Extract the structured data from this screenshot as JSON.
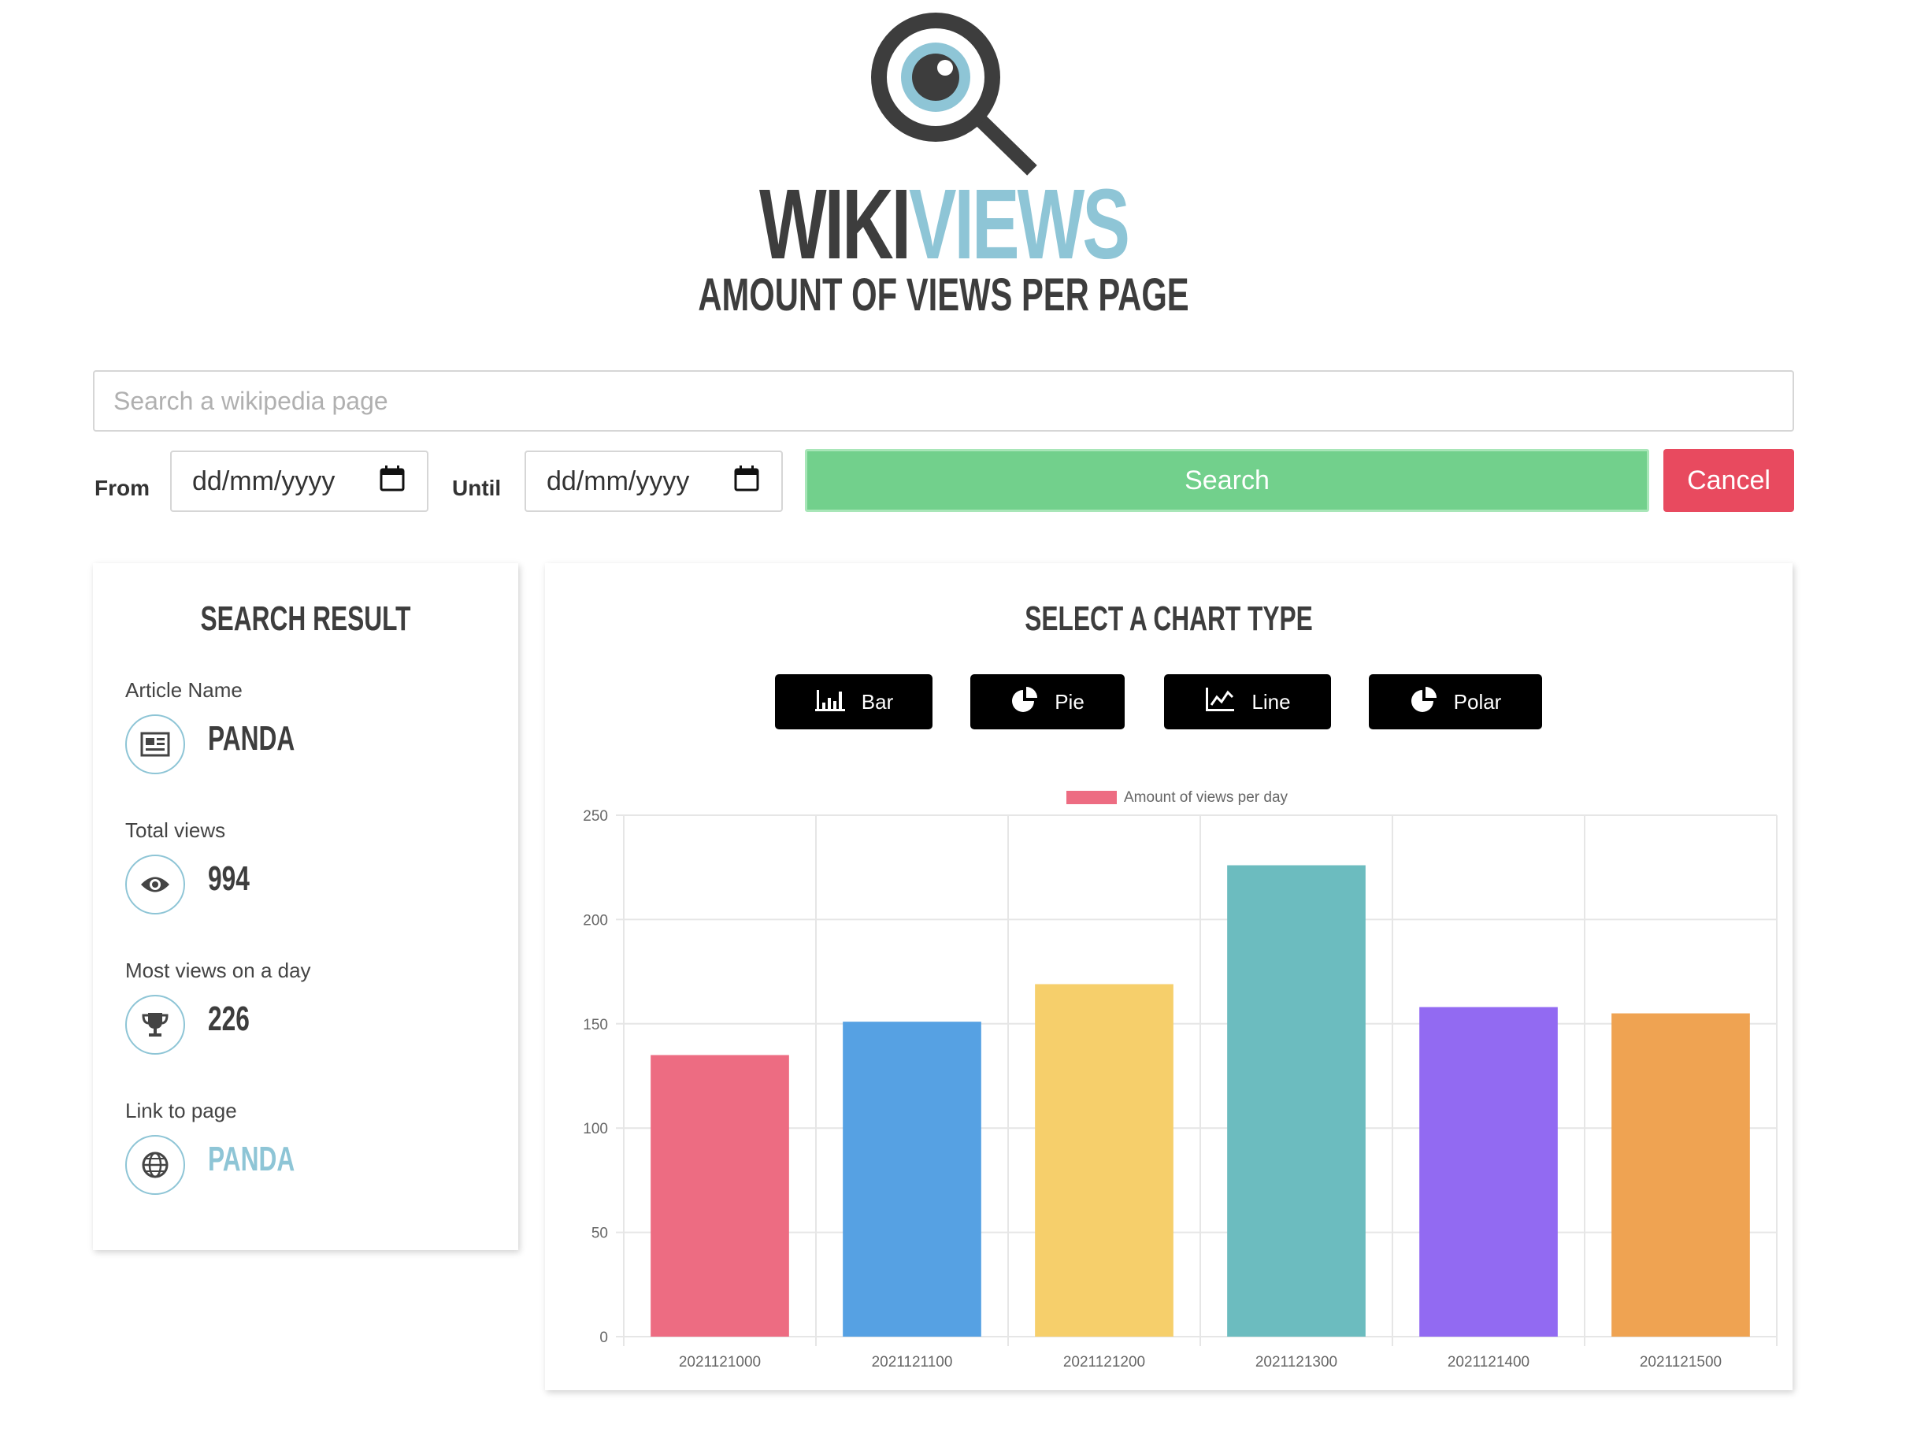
{
  "header": {
    "title_part1": "WIKI",
    "title_part2": "VIEWS",
    "subtitle": "AMOUNT OF VIEWS PER PAGE",
    "logo_icon": "magnifier-eye-icon"
  },
  "search": {
    "placeholder": "Search a wikipedia page",
    "value": ""
  },
  "dates": {
    "from_label": "From",
    "until_label": "Until",
    "from_value": "dd/mm/yyyy",
    "until_value": "dd/mm/yyyy"
  },
  "buttons": {
    "search": "Search",
    "cancel": "Cancel"
  },
  "result": {
    "title": "SEARCH RESULT",
    "article_label": "Article Name",
    "article_value": "PANDA",
    "total_label": "Total views",
    "total_value": "994",
    "most_label": "Most views on a day",
    "most_value": "226",
    "link_label": "Link to page",
    "link_value": "PANDA"
  },
  "chart_select": {
    "title": "SELECT A CHART TYPE",
    "buttons": [
      {
        "label": "Bar",
        "icon": "bar-chart-icon"
      },
      {
        "label": "Pie",
        "icon": "pie-chart-icon"
      },
      {
        "label": "Line",
        "icon": "line-chart-icon"
      },
      {
        "label": "Polar",
        "icon": "polar-chart-icon"
      }
    ]
  },
  "colors": {
    "accent": "#8ec5d6",
    "search": "#72d08c",
    "cancel": "#e84a5f",
    "dark": "#3d3d3d"
  },
  "chart_data": {
    "type": "bar",
    "categories": [
      "2021121000",
      "2021121100",
      "2021121200",
      "2021121300",
      "2021121400",
      "2021121500"
    ],
    "series": [
      {
        "name": "Amount of views per day",
        "values": [
          135,
          151,
          169,
          226,
          158,
          155
        ]
      }
    ],
    "bar_colors": [
      "#ed6c82",
      "#56a1e3",
      "#f6cf6b",
      "#6cbcbf",
      "#926af2",
      "#efa352"
    ],
    "ylim": [
      0,
      250
    ],
    "yticks": [
      0,
      50,
      100,
      150,
      200,
      250
    ],
    "grid": true,
    "legend": "top-center"
  }
}
